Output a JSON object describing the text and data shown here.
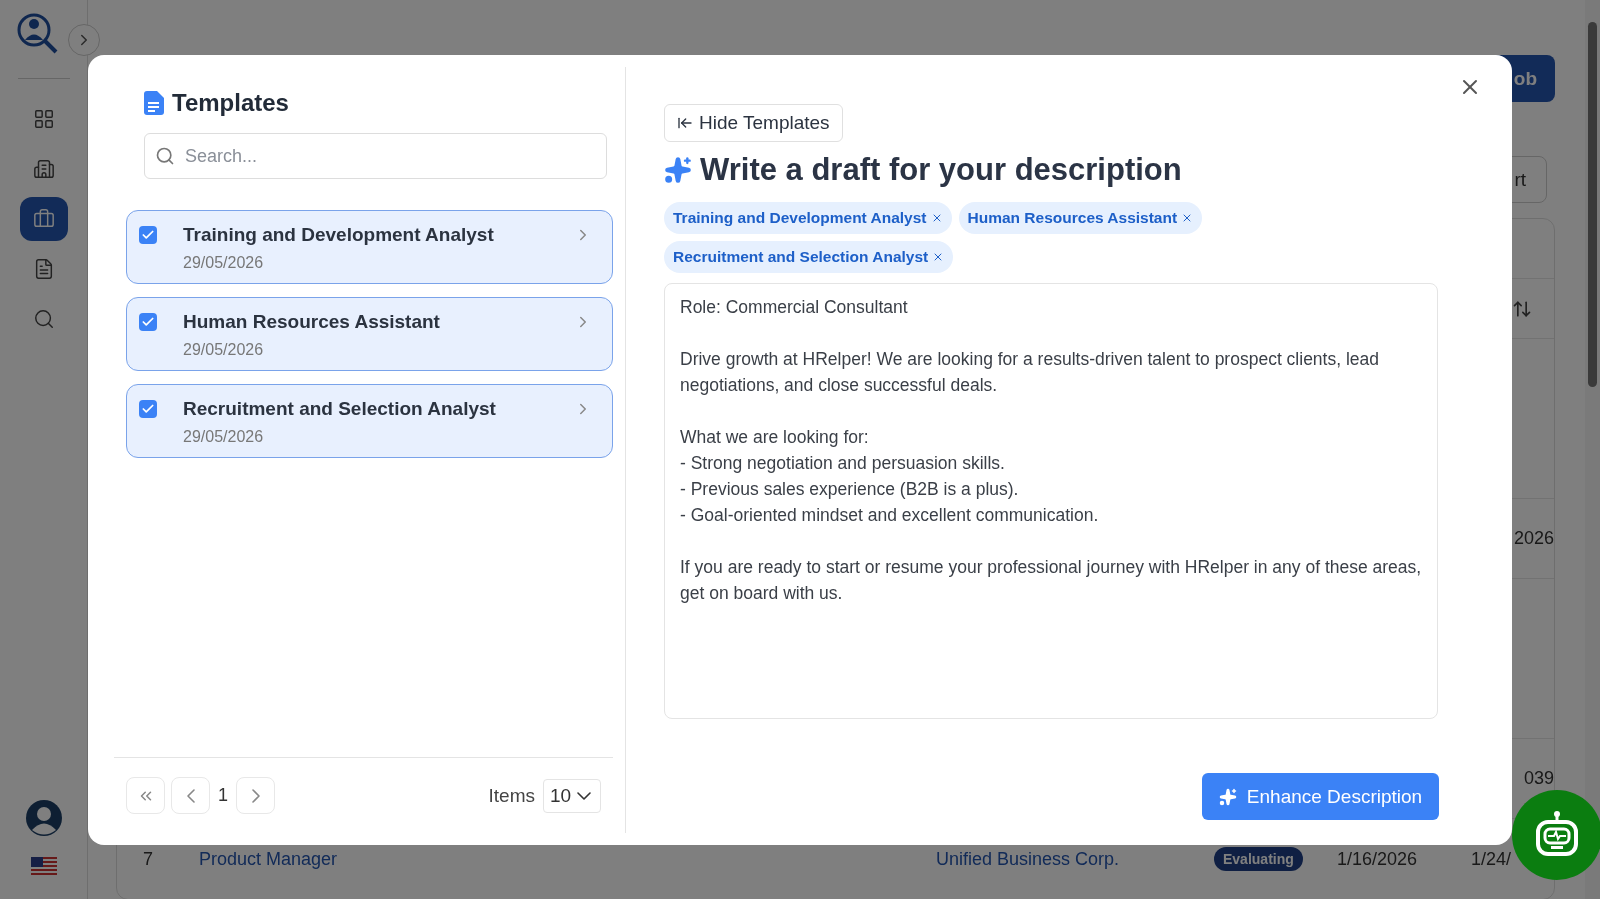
{
  "sidebar": {
    "items": [
      {
        "kind": "dashboard",
        "selected": false
      },
      {
        "kind": "companies",
        "selected": false
      },
      {
        "kind": "jobs",
        "selected": true
      },
      {
        "kind": "documents",
        "selected": false
      },
      {
        "kind": "search",
        "selected": false
      }
    ]
  },
  "page": {
    "primary_button": "ob",
    "secondary_button": "rt",
    "table": {
      "rows": [
        {
          "kind": "covered",
          "text": "2026"
        },
        {
          "kind": "covered",
          "text": "039"
        },
        {
          "kind": "full",
          "number": "7",
          "title": "Product Manager",
          "company": "Unified Business Corp.",
          "status": "Evaluating",
          "start_date": "1/16/2026",
          "end_date": "1/24/"
        }
      ]
    }
  },
  "modal": {
    "templates": {
      "title": "Templates",
      "search": {
        "placeholder": "Search..."
      },
      "items": [
        {
          "title": "Training and Development Analyst",
          "date": "29/05/2026",
          "checked": true
        },
        {
          "title": "Human Resources Assistant",
          "date": "29/05/2026",
          "checked": true
        },
        {
          "title": "Recruitment and Selection Analyst",
          "date": "29/05/2026",
          "checked": true
        }
      ],
      "pagination": {
        "page": "1",
        "items_label": "Items",
        "page_size": "10"
      }
    },
    "editor": {
      "hide_button": "Hide Templates",
      "heading": "Write a draft for your description",
      "chips": [
        {
          "label": "Training and Development Analyst"
        },
        {
          "label": "Human Resources Assistant"
        },
        {
          "label": "Recruitment and Selection Analyst"
        }
      ],
      "description": "Role: Commercial Consultant\n\nDrive growth at HRelper! We are looking for a results-driven talent to prospect clients, lead negotiations, and close successful deals.\n\nWhat we are looking for:\n- Strong negotiation and persuasion skills.\n- Previous sales experience (B2B is a plus).\n- Goal-oriented mindset and excellent communication.\n\nIf you are ready to start or resume your professional journey with HRelper in any of these areas, get on board with us.",
      "enhance_button": "Enhance Description"
    }
  }
}
